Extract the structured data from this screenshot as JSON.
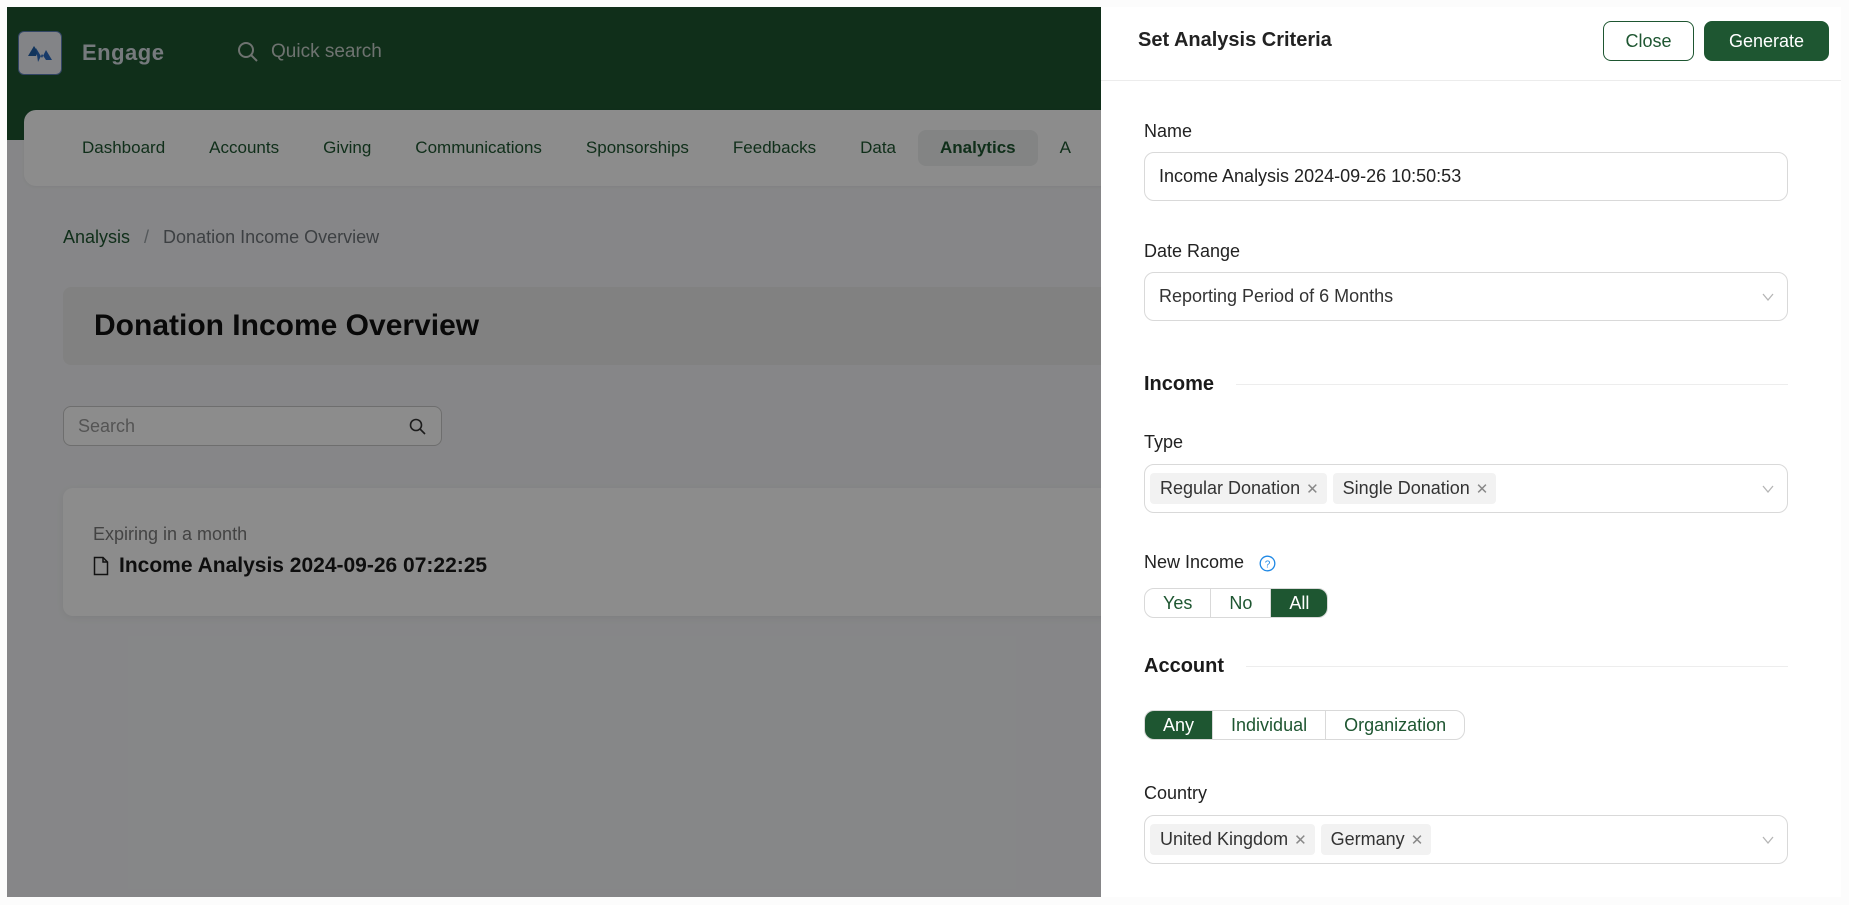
{
  "app": {
    "brand": "Engage",
    "quick_search_placeholder": "Quick search"
  },
  "nav": {
    "items": [
      {
        "label": "Dashboard",
        "active": false
      },
      {
        "label": "Accounts",
        "active": false
      },
      {
        "label": "Giving",
        "active": false
      },
      {
        "label": "Communications",
        "active": false
      },
      {
        "label": "Sponsorships",
        "active": false
      },
      {
        "label": "Feedbacks",
        "active": false
      },
      {
        "label": "Data",
        "active": false
      },
      {
        "label": "Analytics",
        "active": true
      },
      {
        "label": "A",
        "active": false
      }
    ]
  },
  "breadcrumb": {
    "parent": "Analysis",
    "separator": "/",
    "current": "Donation Income Overview"
  },
  "page": {
    "title": "Donation Income Overview",
    "search_placeholder": "Search",
    "reports": [
      {
        "status": "Expiring in a month",
        "name": "Income Analysis 2024-09-26 07:22:25"
      }
    ]
  },
  "drawer": {
    "title": "Set Analysis Criteria",
    "close_label": "Close",
    "generate_label": "Generate",
    "name": {
      "label": "Name",
      "value": "Income Analysis 2024-09-26 10:50:53"
    },
    "date_range": {
      "label": "Date Range",
      "value": "Reporting Period of 6 Months"
    },
    "income_section": "Income",
    "type": {
      "label": "Type",
      "tags": [
        "Regular Donation",
        "Single Donation"
      ]
    },
    "new_income": {
      "label": "New Income",
      "options": [
        "Yes",
        "No",
        "All"
      ],
      "selected": "All"
    },
    "account_section": "Account",
    "account_type": {
      "options": [
        "Any",
        "Individual",
        "Organization"
      ],
      "selected": "Any"
    },
    "country": {
      "label": "Country",
      "tags": [
        "United Kingdom",
        "Germany"
      ]
    }
  },
  "colors": {
    "brand_green": "#1e5631",
    "help_blue": "#1e88e5"
  }
}
